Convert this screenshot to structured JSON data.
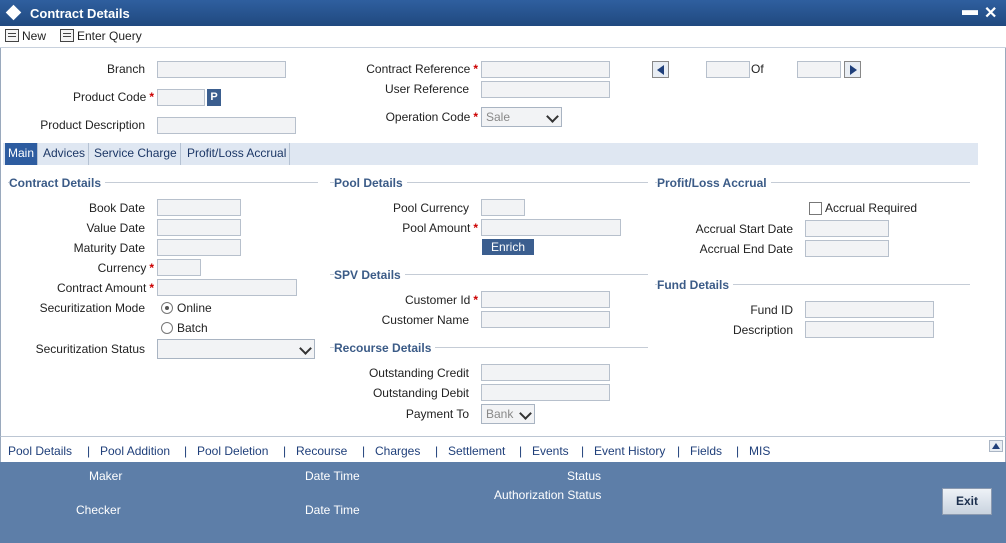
{
  "window": {
    "title": "Contract Details",
    "minimize": "▬",
    "close": "✕"
  },
  "toolbar": {
    "new_label": "New",
    "enter_query_label": "Enter Query"
  },
  "header": {
    "branch_label": "Branch",
    "product_code_label": "Product Code",
    "product_code_button": "P",
    "product_description_label": "Product Description",
    "contract_reference_label": "Contract Reference",
    "user_reference_label": "User Reference",
    "operation_code_label": "Operation Code",
    "operation_code_value": "Sale",
    "of_label": "Of",
    "required_mark": "*"
  },
  "tabs": [
    {
      "label": "Main",
      "active": true
    },
    {
      "label": "Advices",
      "active": false
    },
    {
      "label": "Service Charge",
      "active": false
    },
    {
      "label": "Profit/Loss Accrual",
      "active": false
    }
  ],
  "contract_details": {
    "title": "Contract Details",
    "book_date_label": "Book Date",
    "value_date_label": "Value Date",
    "maturity_date_label": "Maturity Date",
    "currency_label": "Currency",
    "contract_amount_label": "Contract Amount",
    "securitization_mode_label": "Securitization Mode",
    "online_label": "Online",
    "batch_label": "Batch",
    "securitization_status_label": "Securitization Status"
  },
  "pool_details": {
    "title": "Pool Details",
    "pool_currency_label": "Pool Currency",
    "pool_amount_label": "Pool Amount",
    "enrich_label": "Enrich"
  },
  "spv_details": {
    "title": "SPV Details",
    "customer_id_label": "Customer Id",
    "customer_name_label": "Customer Name"
  },
  "recourse_details": {
    "title": "Recourse Details",
    "outstanding_credit_label": "Outstanding Credit",
    "outstanding_debit_label": "Outstanding Debit",
    "payment_to_label": "Payment To",
    "payment_to_value": "Bank"
  },
  "profit_loss_accrual": {
    "title": "Profit/Loss Accrual",
    "accrual_required_label": "Accrual Required",
    "accrual_start_date_label": "Accrual Start Date",
    "accrual_end_date_label": "Accrual End Date"
  },
  "fund_details": {
    "title": "Fund Details",
    "fund_id_label": "Fund ID",
    "description_label": "Description"
  },
  "subscreens": [
    "Pool Details",
    "Pool Addition",
    "Pool Deletion",
    "Recourse",
    "Charges",
    "Settlement",
    "Events",
    "Event History",
    "Fields",
    "MIS"
  ],
  "footer": {
    "maker_label": "Maker",
    "checker_label": "Checker",
    "date_time_label": "Date Time",
    "status_label": "Status",
    "authorization_status_label": "Authorization Status",
    "exit_label": "Exit"
  },
  "colors": {
    "titlebar": "#2a5590",
    "footer": "#5d7ea8",
    "active_tab": "#2d5ca0",
    "section_title": "#3b5b87",
    "required": "#cc0000"
  }
}
